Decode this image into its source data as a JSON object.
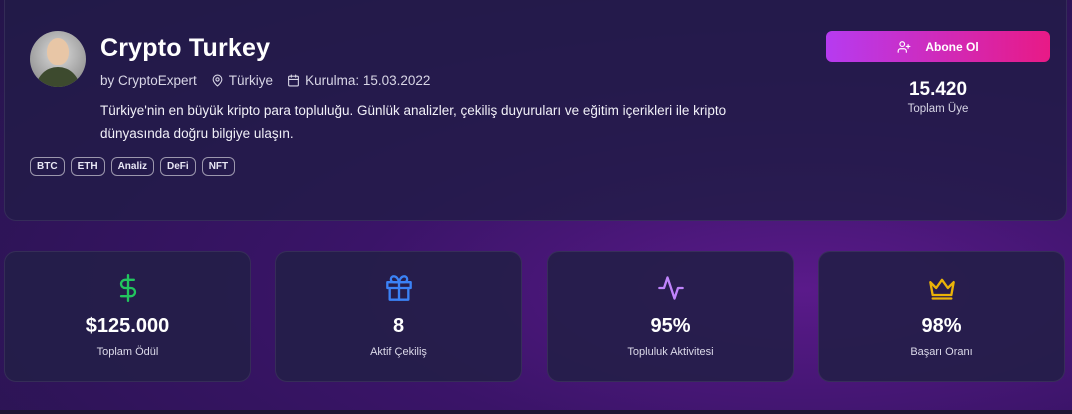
{
  "community": {
    "name": "Crypto Turkey",
    "author": "by CryptoExpert",
    "location": "Türkiye",
    "founded": "Kurulma: 15.03.2022",
    "description": "Türkiye'nin en büyük kripto para topluluğu. Günlük analizler, çekiliş duyuruları ve eğitim içerikleri ile kripto dünyasında doğru bilgiye ulaşın.",
    "tags": [
      "BTC",
      "ETH",
      "Analiz",
      "DeFi",
      "NFT"
    ]
  },
  "subscribe": {
    "label": "Abone Ol",
    "icon": "user-plus-icon"
  },
  "members": {
    "count": "15.420",
    "label": "Toplam Üye"
  },
  "stats": [
    {
      "value": "$125.000",
      "label": "Toplam Ödül",
      "icon": "dollar-icon",
      "color": "#22c55e"
    },
    {
      "value": "8",
      "label": "Aktif Çekiliş",
      "icon": "gift-icon",
      "color": "#3b82f6"
    },
    {
      "value": "95%",
      "label": "Topluluk Aktivitesi",
      "icon": "activity-icon",
      "color": "#c084fc"
    },
    {
      "value": "98%",
      "label": "Başarı Oranı",
      "icon": "crown-icon",
      "color": "#eab308"
    }
  ],
  "colors": {
    "accent_gradient_start": "#b63bf0",
    "accent_gradient_end": "#e81a86"
  }
}
